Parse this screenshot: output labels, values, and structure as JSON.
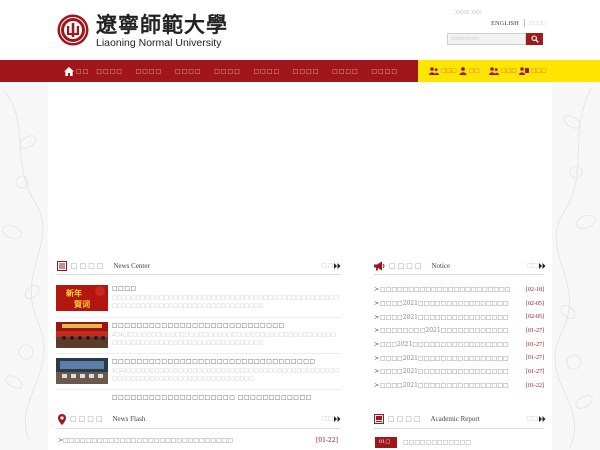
{
  "header": {
    "logo_cn": "遼寧師範大學",
    "logo_en": "Liaoning Normal University",
    "top_site": "xxxx.xxx",
    "lang_en": "ENGLISH",
    "lang_alt": "□□□□",
    "search_placeholder": "□□□□□□□□□"
  },
  "nav": {
    "home": "□□",
    "items": [
      "□□□□",
      "□□□□",
      "□□□□",
      "□□□□",
      "□□□□",
      "□□□□",
      "□□□□",
      "□□□□"
    ],
    "quick_links": [
      "□□□",
      "□□",
      "□□□",
      "□□□"
    ]
  },
  "news_center": {
    "title_cn": "□□□□",
    "title_en": "News Center",
    "more": "□□",
    "items": [
      {
        "title": "□□□□",
        "text": "□□□□□□□□□□□□□□□□□□□□□□□□□□□□□□□□□□□□□□□□□□□□□□□□□□□□□□□□□□□□□□□□□□□□□□□□□□□□□□□□"
      },
      {
        "title": "□□□□□□□□□□□□□□□□□□□□□□□□□□□□",
        "text": "2□1□□□□□□□□□□□□□□□□□□□□□□□□□□□□□□□□□□□□□□□□□□□□□□□□□□□□□□□□□□□□□□□□□□□□□□□□□□□□□"
      },
      {
        "title": "□□□□□□□□□□□□□□□□□□□□□□□□□□□□□□□□□",
        "text": "1□22□□□□□□□□□□□□□□□□□□□□□□□□□□□□□□□□□□□□□□□□□□□□□□□□□□□□□□□□□□□□□□□□□□□□□□□□□□□"
      },
      {
        "title": "□□□□□□□□□□□□□□□□□□□□ □□□□□□□□□□□□",
        "text": ""
      }
    ]
  },
  "notice": {
    "title_cn": "□□□□",
    "title_en": "Notice",
    "more": "□□",
    "items": [
      {
        "text": "□□□□□□□□□□□□□□□□□□□□□□□",
        "date": "[02-18]"
      },
      {
        "text": "□□□□2021□□□□□□□□□□□□□□□□",
        "date": "[02-05]"
      },
      {
        "text": "□□□□2021□□□□□□□□□□□□□□□□",
        "date": "[02-05]"
      },
      {
        "text": "□□□□□□□□2021□□□□□□□□□□□□",
        "date": "[01-27]"
      },
      {
        "text": "□□□2021□□□□□□□□□□□□□□□□□",
        "date": "[01-27]"
      },
      {
        "text": "□□□□2021□□□□□□□□□□□□□□□□",
        "date": "[01-27]"
      },
      {
        "text": "□□□□2021□□□□□□□□□□□□□□□□",
        "date": "[01-27]"
      },
      {
        "text": "□□□□2021□□□□□□□□□□□□□□□□",
        "date": "[01-22]"
      }
    ]
  },
  "news_flash": {
    "title_cn": "□□□□",
    "title_en": "News Flash",
    "more": "□□",
    "items": [
      {
        "text": "□□□□□□□□□□□□□□□□□□□□□□□□□□□□□□",
        "date": "[01-22]"
      }
    ]
  },
  "academic_report": {
    "title_cn": "□□□□",
    "title_en": "Academic Report",
    "more": "□□",
    "items": [
      {
        "date": "01□",
        "text": "□□□□□□□□□□□□"
      }
    ]
  },
  "thumb_banner_text": "新年賀词",
  "colors": {
    "brand_red": "#a0161a",
    "nav_yellow": "#ffe600",
    "date_red": "#a0161a"
  }
}
